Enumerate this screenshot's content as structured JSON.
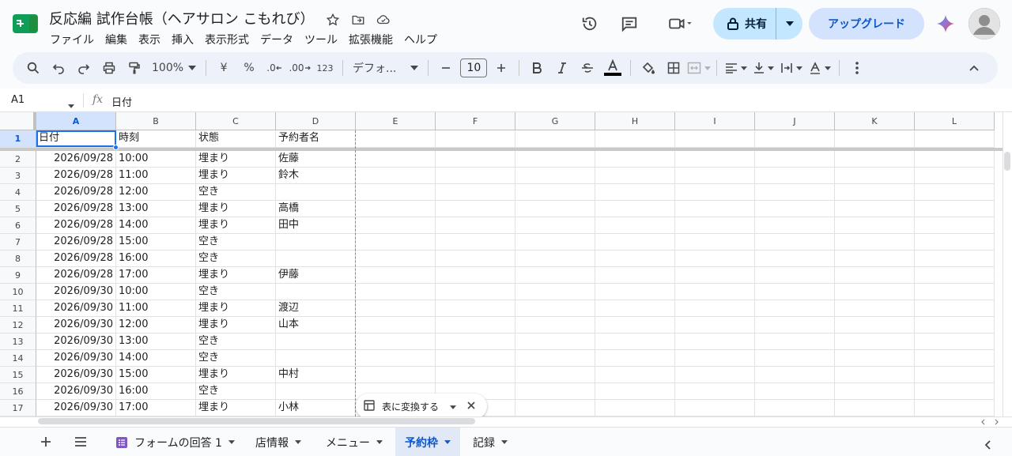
{
  "app": {
    "title": "反応編 試作台帳（ヘアサロン こもれび）",
    "menu": [
      "ファイル",
      "編集",
      "表示",
      "挿入",
      "表示形式",
      "データ",
      "ツール",
      "拡張機能",
      "ヘルプ"
    ],
    "share_label": "共有",
    "upgrade_label": "アップグレード",
    "accent": "#0b57d0",
    "share_bg": "#c2e7ff"
  },
  "toolbar": {
    "zoom": "100%",
    "currency": "¥",
    "percent": "%",
    "dec_decrease": ".0",
    "dec_increase": ".00",
    "number_format": "123",
    "font": "デフォ...",
    "font_size": "10"
  },
  "formula_bar": {
    "cell_ref": "A1",
    "fx": "fx",
    "value": "日付"
  },
  "grid": {
    "columns": [
      "A",
      "B",
      "C",
      "D",
      "E",
      "F",
      "G",
      "H",
      "I",
      "J",
      "K",
      "L"
    ],
    "header_row": {
      "row": "1",
      "cells": [
        "日付",
        "時刻",
        "状態",
        "予約者名"
      ]
    },
    "rows": [
      {
        "row": "2",
        "date": "2026/09/28",
        "time": "10:00",
        "status": "埋まり",
        "name": "佐藤"
      },
      {
        "row": "3",
        "date": "2026/09/28",
        "time": "11:00",
        "status": "埋まり",
        "name": "鈴木"
      },
      {
        "row": "4",
        "date": "2026/09/28",
        "time": "12:00",
        "status": "空き",
        "name": ""
      },
      {
        "row": "5",
        "date": "2026/09/28",
        "time": "13:00",
        "status": "埋まり",
        "name": "高橋"
      },
      {
        "row": "6",
        "date": "2026/09/28",
        "time": "14:00",
        "status": "埋まり",
        "name": "田中"
      },
      {
        "row": "7",
        "date": "2026/09/28",
        "time": "15:00",
        "status": "空き",
        "name": ""
      },
      {
        "row": "8",
        "date": "2026/09/28",
        "time": "16:00",
        "status": "空き",
        "name": ""
      },
      {
        "row": "9",
        "date": "2026/09/28",
        "time": "17:00",
        "status": "埋まり",
        "name": "伊藤"
      },
      {
        "row": "10",
        "date": "2026/09/30",
        "time": "10:00",
        "status": "空き",
        "name": ""
      },
      {
        "row": "11",
        "date": "2026/09/30",
        "time": "11:00",
        "status": "埋まり",
        "name": "渡辺"
      },
      {
        "row": "12",
        "date": "2026/09/30",
        "time": "12:00",
        "status": "埋まり",
        "name": "山本"
      },
      {
        "row": "13",
        "date": "2026/09/30",
        "time": "13:00",
        "status": "空き",
        "name": ""
      },
      {
        "row": "14",
        "date": "2026/09/30",
        "time": "14:00",
        "status": "空き",
        "name": ""
      },
      {
        "row": "15",
        "date": "2026/09/30",
        "time": "15:00",
        "status": "埋まり",
        "name": "中村"
      },
      {
        "row": "16",
        "date": "2026/09/30",
        "time": "16:00",
        "status": "空き",
        "name": ""
      },
      {
        "row": "17",
        "date": "2026/09/30",
        "time": "17:00",
        "status": "埋まり",
        "name": "小林"
      }
    ]
  },
  "convert_chip": {
    "label": "表に変換する"
  },
  "sheets": {
    "tabs": [
      "フォームの回答 1",
      "店情報",
      "メニュー",
      "予約枠",
      "記録"
    ],
    "active": "予約枠"
  }
}
